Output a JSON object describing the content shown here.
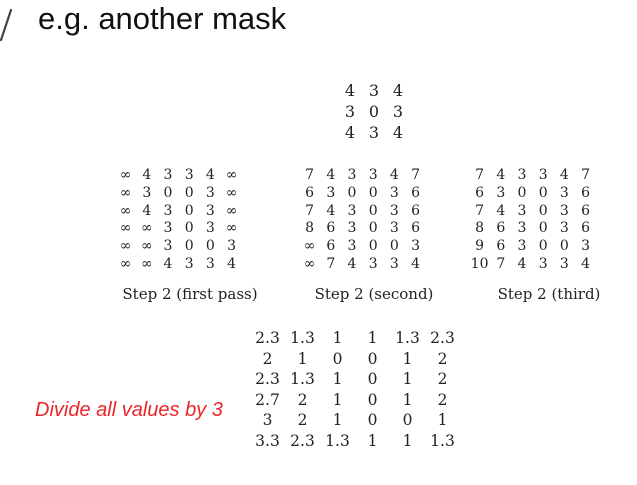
{
  "header": {
    "bullet_icon": "checkmark-icon",
    "title": "e.g. another mask"
  },
  "mask": [
    [
      "4",
      "3",
      "4"
    ],
    [
      "3",
      "0",
      "3"
    ],
    [
      "4",
      "3",
      "4"
    ]
  ],
  "steps": [
    {
      "caption": "Step 2 (first pass)",
      "rows": [
        [
          "∞",
          "4",
          "3",
          "3",
          "4",
          "∞"
        ],
        [
          "∞",
          "3",
          "0",
          "0",
          "3",
          "∞"
        ],
        [
          "∞",
          "4",
          "3",
          "0",
          "3",
          "∞"
        ],
        [
          "∞",
          "∞",
          "3",
          "0",
          "3",
          "∞"
        ],
        [
          "∞",
          "∞",
          "3",
          "0",
          "0",
          "3"
        ],
        [
          "∞",
          "∞",
          "4",
          "3",
          "3",
          "4"
        ]
      ]
    },
    {
      "caption": "Step 2 (second)",
      "rows": [
        [
          "7",
          "4",
          "3",
          "3",
          "4",
          "7"
        ],
        [
          "6",
          "3",
          "0",
          "0",
          "3",
          "6"
        ],
        [
          "7",
          "4",
          "3",
          "0",
          "3",
          "6"
        ],
        [
          "8",
          "6",
          "3",
          "0",
          "3",
          "6"
        ],
        [
          "∞",
          "6",
          "3",
          "0",
          "0",
          "3"
        ],
        [
          "∞",
          "7",
          "4",
          "3",
          "3",
          "4"
        ]
      ]
    },
    {
      "caption": "Step 2 (third)",
      "rows": [
        [
          "7",
          "4",
          "3",
          "3",
          "4",
          "7"
        ],
        [
          "6",
          "3",
          "0",
          "0",
          "3",
          "6"
        ],
        [
          "7",
          "4",
          "3",
          "0",
          "3",
          "6"
        ],
        [
          "8",
          "6",
          "3",
          "0",
          "3",
          "6"
        ],
        [
          "9",
          "6",
          "3",
          "0",
          "0",
          "3"
        ],
        [
          "10",
          "7",
          "4",
          "3",
          "3",
          "4"
        ]
      ]
    }
  ],
  "result": [
    [
      "2.3",
      "1.3",
      "1",
      "1",
      "1.3",
      "2.3"
    ],
    [
      "2",
      "1",
      "0",
      "0",
      "1",
      "2"
    ],
    [
      "2.3",
      "1.3",
      "1",
      "0",
      "1",
      "2"
    ],
    [
      "2.7",
      "2",
      "1",
      "0",
      "1",
      "2"
    ],
    [
      "3",
      "2",
      "1",
      "0",
      "0",
      "1"
    ],
    [
      "3.3",
      "2.3",
      "1.3",
      "1",
      "1",
      "1.3"
    ]
  ],
  "note": {
    "text": "Divide all values by 3",
    "color": "#e8262b"
  }
}
